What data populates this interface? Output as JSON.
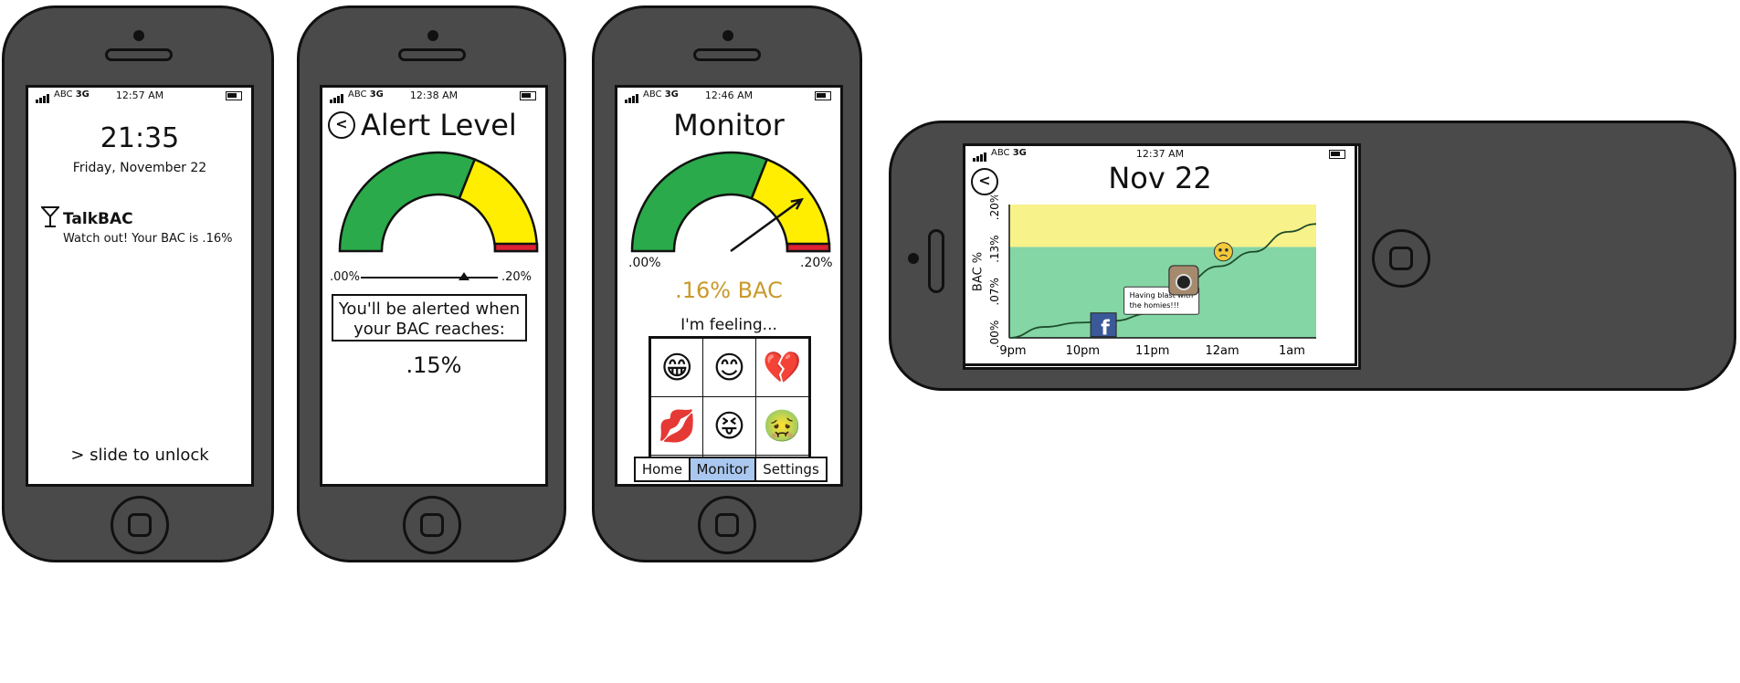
{
  "status_bar": {
    "carrier": "ABC",
    "network": "3G"
  },
  "lock_screen": {
    "status_time": "12:57 AM",
    "clock": "21:35",
    "date": "Friday, November 22",
    "notification_app": "TalkBAC",
    "notification_text": "Watch out! Your BAC is .16%",
    "unlock_text": "> slide to unlock"
  },
  "alert_screen": {
    "status_time": "12:38 AM",
    "title": "Alert Level",
    "slider_min": ".00%",
    "slider_max": ".20%",
    "slider_value_fraction": 0.75,
    "message": "You'll be alerted when your BAC reaches:",
    "alert_value": ".15%"
  },
  "monitor_screen": {
    "status_time": "12:46 AM",
    "title": "Monitor",
    "gauge_min": ".00%",
    "gauge_max": ".20%",
    "needle_fraction": 0.8,
    "bac_reading": ".16% BAC",
    "feeling_label": "I'm feeling...",
    "emojis": [
      "😁",
      "😊",
      "💔",
      "💋",
      "😝",
      "🤢",
      "😁",
      "😎",
      "😳"
    ],
    "tabs": [
      "Home",
      "Monitor",
      "Settings"
    ],
    "active_tab": "Monitor"
  },
  "history_screen": {
    "status_time": "12:37 AM",
    "title": "Nov 22",
    "caption": "Having blast with the homies!!!"
  },
  "colors": {
    "green": "#2aaa4a",
    "yellow": "#ffee00",
    "red": "#dd2233",
    "bac_text": "#c89a2a",
    "chart_green": "#84d6a4",
    "chart_yellow": "#f7f28a",
    "tab_active": "#a9c7ef",
    "facebook": "#3b5998"
  },
  "chart_data": {
    "type": "line",
    "xlabel": "",
    "ylabel": "BAC %",
    "x": [
      "9pm",
      "10pm",
      "11pm",
      "12am",
      "1am"
    ],
    "x_hours": [
      0,
      0.5,
      1,
      1.5,
      2,
      2.5,
      3,
      3.5,
      4,
      4.4
    ],
    "y": [
      0.0,
      0.018,
      0.025,
      0.028,
      0.04,
      0.09,
      0.118,
      0.142,
      0.175,
      0.188
    ],
    "yticks": [
      ".00%",
      ".07%",
      ".13%",
      ".20%"
    ],
    "ylim": [
      0,
      0.22
    ],
    "bands": [
      {
        "from": 0,
        "to": 0.15,
        "color": "green"
      },
      {
        "from": 0.15,
        "to": 0.22,
        "color": "yellow"
      }
    ],
    "annotations": [
      "facebook-post",
      "instagram-post",
      "sick-emoji"
    ]
  }
}
